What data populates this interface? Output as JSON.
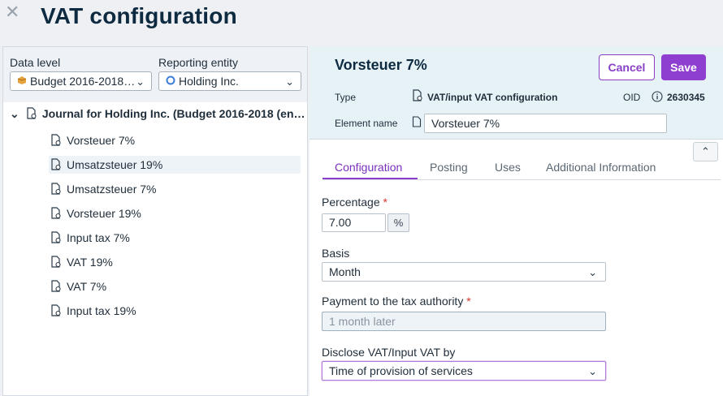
{
  "header": {
    "title": "VAT configuration",
    "close_glyph": "✕"
  },
  "left": {
    "data_level_label": "Data level",
    "data_level_value": "Budget 2016-2018…",
    "reporting_entity_label": "Reporting entity",
    "reporting_entity_value": "Holding Inc.",
    "tree": {
      "root_label": "Journal for Holding Inc. (Budget 2016-2018 (en…",
      "items": [
        {
          "label": "Vorsteuer 7%"
        },
        {
          "label": "Umsatzsteuer 19%"
        },
        {
          "label": "Umsatzsteuer 7%"
        },
        {
          "label": "Vorsteuer 19%"
        },
        {
          "label": "Input tax 7%"
        },
        {
          "label": "VAT 19%"
        },
        {
          "label": "VAT 7%"
        },
        {
          "label": "Input tax 19%"
        }
      ]
    }
  },
  "detail": {
    "title": "Vorsteuer 7%",
    "cancel_label": "Cancel",
    "save_label": "Save",
    "type_label": "Type",
    "type_value": "VAT/input VAT configuration",
    "oid_label": "OID",
    "oid_value": "2630345",
    "element_name_label": "Element name",
    "element_name_value": "Vorsteuer 7%",
    "tabs": [
      {
        "label": "Configuration",
        "active": true
      },
      {
        "label": "Posting"
      },
      {
        "label": "Uses"
      },
      {
        "label": "Additional Information"
      }
    ],
    "form": {
      "percentage_label": "Percentage",
      "required_mark": "*",
      "percentage_value": "7.00",
      "percentage_unit": "%",
      "basis_label": "Basis",
      "basis_value": "Month",
      "payment_label": "Payment to the tax authority",
      "payment_placeholder": "1 month later",
      "disclose_label": "Disclose VAT/Input VAT by",
      "disclose_value": "Time of provision of services"
    }
  },
  "colors": {
    "accent": "#8e3fcf",
    "header_bg": "#e6f2f6",
    "required": "#d9342b"
  },
  "icons": [
    "close-icon",
    "chevron-down-icon",
    "document-gear-icon",
    "info-icon",
    "document-icon",
    "chevron-up-double-icon"
  ]
}
